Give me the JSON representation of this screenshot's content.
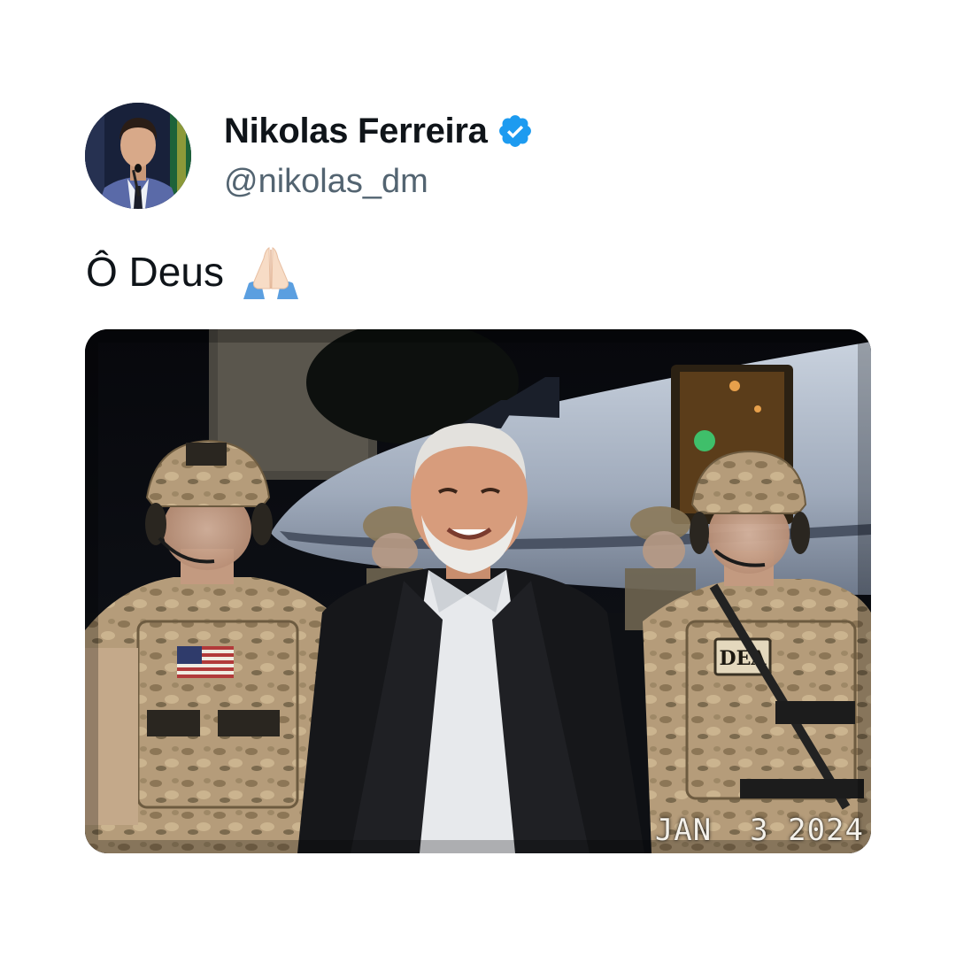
{
  "author": {
    "display_name": "Nikolas Ferreira",
    "handle": "@nikolas_dm",
    "verified": true,
    "avatar": "profile-photo"
  },
  "tweet": {
    "text": "Ô Deus",
    "emoji": "folded-hands-icon"
  },
  "media": {
    "type": "photo",
    "date_stamp": "JAN  3 2024",
    "patch_text": "DEA"
  },
  "colors": {
    "verified_blue": "#1d9bf0",
    "text_primary": "#0f1419",
    "text_secondary": "#536471"
  }
}
